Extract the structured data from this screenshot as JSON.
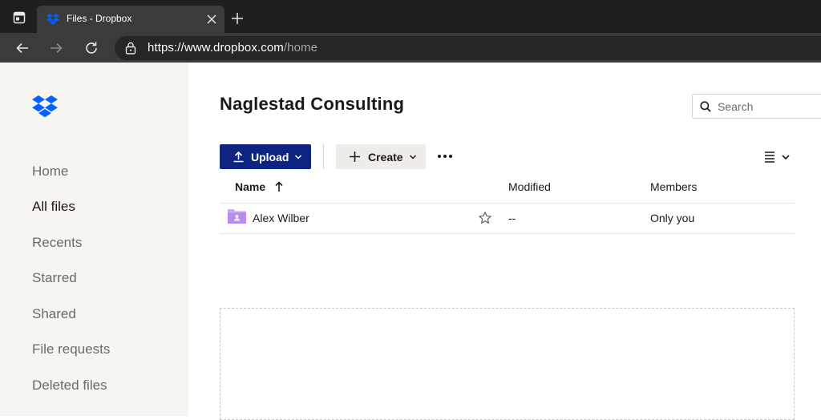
{
  "browser": {
    "tab_title": "Files - Dropbox",
    "url_host": "https://www.dropbox.com",
    "url_path": "/home"
  },
  "sidebar": {
    "items": [
      {
        "label": "Home",
        "active": false
      },
      {
        "label": "All files",
        "active": true
      },
      {
        "label": "Recents",
        "active": false
      },
      {
        "label": "Starred",
        "active": false
      },
      {
        "label": "Shared",
        "active": false
      },
      {
        "label": "File requests",
        "active": false
      },
      {
        "label": "Deleted files",
        "active": false
      }
    ]
  },
  "main": {
    "title": "Naglestad Consulting",
    "search_placeholder": "Search",
    "upload_label": "Upload",
    "create_label": "Create",
    "columns": {
      "name": "Name",
      "modified": "Modified",
      "members": "Members"
    },
    "rows": [
      {
        "name": "Alex Wilber",
        "modified": "--",
        "members": "Only you",
        "icon": "shared-folder-icon"
      }
    ]
  },
  "colors": {
    "brand_blue": "#0061fe",
    "upload_button": "#0d2481",
    "sidebar_bg": "#f7f5f2",
    "folder_purple": "#c7a8f0"
  }
}
